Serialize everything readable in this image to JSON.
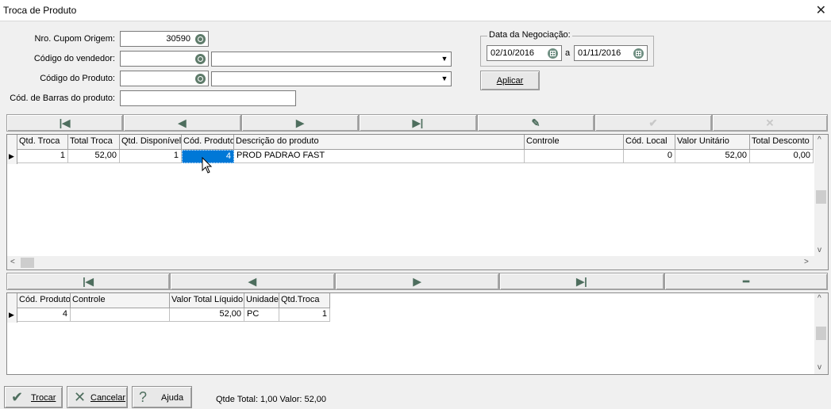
{
  "window": {
    "title": "Troca de Produto"
  },
  "form": {
    "cupom_label": "Nro. Cupom Origem:",
    "cupom_value": "30590",
    "vendedor_label": "Código do vendedor:",
    "vendedor_value": "",
    "vendedor_select": "",
    "produto_label": "Código do Produto:",
    "produto_value": "",
    "produto_select": "",
    "barras_label": "Cód. de Barras do produto:",
    "barras_value": ""
  },
  "negociacao": {
    "label": "Data da Negociação:",
    "date_from": "02/10/2016",
    "separator": "a",
    "date_to": "01/11/2016",
    "apply_label": "Aplicar"
  },
  "grid1": {
    "columns": [
      "Qtd. Troca",
      "Total Troca",
      "Qtd. Disponível",
      "Cód. Produto",
      "Descrição do produto",
      "Controle",
      "Cód. Local",
      "Valor Unitário",
      "Total Desconto"
    ],
    "rows": [
      [
        "1",
        "52,00",
        "1",
        "4",
        "PROD PADRAO FAST",
        "",
        "0",
        "52,00",
        "0,00"
      ]
    ]
  },
  "grid2": {
    "columns": [
      "Cód. Produto",
      "Controle",
      "Valor Total Líquido",
      "Unidade",
      "Qtd.Troca"
    ],
    "rows": [
      [
        "4",
        "",
        "52,00",
        "PC",
        "1"
      ]
    ]
  },
  "footer": {
    "trocar_label": "Trocar",
    "cancelar_label": "Cancelar",
    "ajuda_label": "Ajuda",
    "status": "Qtde Total: 1,00 Valor: 52,00"
  },
  "icons": {
    "nav_first": "first-record-icon",
    "nav_prev": "previous-record-icon",
    "nav_next": "next-record-icon",
    "nav_last": "last-record-icon",
    "nav_edit": "edit-icon",
    "nav_post": "confirm-icon",
    "nav_cancel": "cancel-edit-icon",
    "nav_delete": "delete-icon"
  },
  "colors": {
    "selected_cell": "#0078d7",
    "nav_icon": "#4e6e5e"
  }
}
